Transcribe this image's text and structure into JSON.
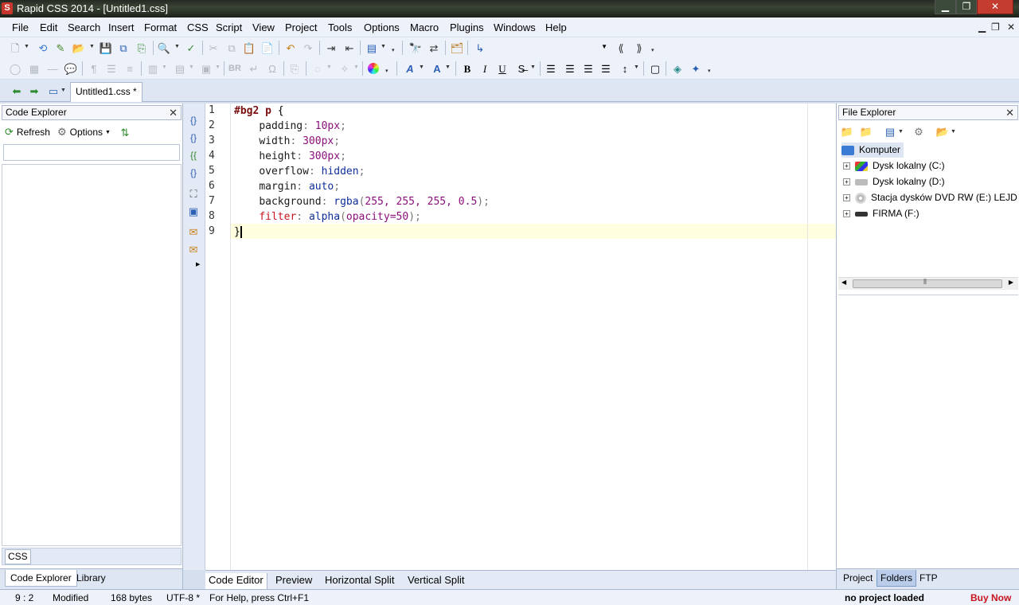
{
  "window": {
    "title": "Rapid CSS 2014 - [Untitled1.css]",
    "app_icon": "S"
  },
  "menu": [
    "File",
    "Edit",
    "Search",
    "Insert",
    "Format",
    "CSS",
    "Script",
    "View",
    "Project",
    "Tools",
    "Options",
    "Macro",
    "Plugins",
    "Windows",
    "Help"
  ],
  "format_toolbar": {
    "bold": "B",
    "italic": "I",
    "underline": "U",
    "br": "BR"
  },
  "document_tab": {
    "label": "Untitled1.css *"
  },
  "code_explorer": {
    "title": "Code Explorer",
    "refresh": "Refresh",
    "options": "Options",
    "search_value": "",
    "bottom_tab": "CSS",
    "tabs": [
      "Code Explorer",
      "Library"
    ]
  },
  "editor": {
    "line_numbers": [
      "1",
      "2",
      "3",
      "4",
      "5",
      "6",
      "7",
      "8",
      "9"
    ],
    "selector": "#bg2 p",
    "open_brace": "{",
    "close_brace": "}",
    "decls": [
      {
        "prop": "padding",
        "val": "10px"
      },
      {
        "prop": "width",
        "val": "300px"
      },
      {
        "prop": "height",
        "val": "300px"
      },
      {
        "prop": "overflow",
        "val": "hidden"
      },
      {
        "prop": "margin",
        "val": "auto"
      },
      {
        "prop": "background",
        "fn": "rgba",
        "args": "255, 255, 255, 0.5"
      },
      {
        "prop": "filter",
        "fn": "alpha",
        "args": "opacity=50"
      }
    ],
    "tabs": [
      "Code Editor",
      "Preview",
      "Horizontal Split",
      "Vertical Split"
    ]
  },
  "file_explorer": {
    "title": "File Explorer",
    "root": "Komputer",
    "drives": [
      "Dysk lokalny (C:)",
      "Dysk lokalny (D:)",
      "Stacja dysków DVD RW (E:) LEJDIS",
      "FIRMA (F:)"
    ],
    "tabs": [
      "Project",
      "Folders",
      "FTP"
    ]
  },
  "status": {
    "position": "9 : 2",
    "state": "Modified",
    "size": "168 bytes",
    "encoding": "UTF-8 *",
    "help": "For Help, press Ctrl+F1",
    "project": "no project loaded",
    "buy": "Buy Now"
  },
  "colors": {
    "buy_now": "#c8141e",
    "selector": "#7a0f0f",
    "value": "#0f2f9a",
    "number": "#8b0f7a",
    "current_line": "#ffffe0"
  }
}
